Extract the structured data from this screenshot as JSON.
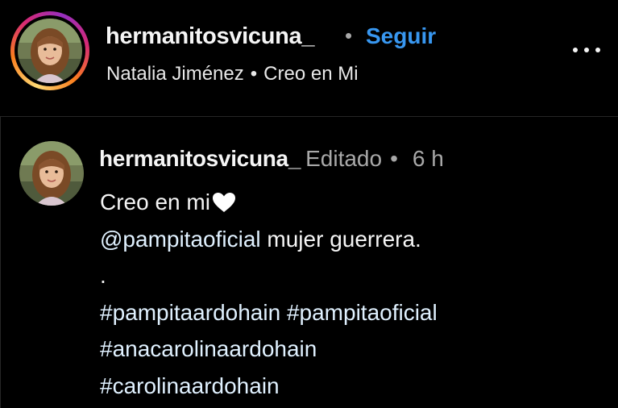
{
  "header": {
    "username": "hermanitosvicuna_",
    "separator": "•",
    "follow_label": "Seguir",
    "audio": {
      "artist": "Natalia Jiménez",
      "separator": "•",
      "song": "Creo en Mi"
    },
    "more_icon": "more-horizontal-icon"
  },
  "caption": {
    "username": "hermanitosvicuna_",
    "edited_label": "Editado",
    "separator": "•",
    "time": "6 h",
    "lines": {
      "line1": "Creo en mi",
      "line2_mention": "@pampitaoficial",
      "line2_rest": " mujer guerrera.",
      "line3": ".",
      "line4_tag1": "#pampitaardohain",
      "line4_tag2": "#pampitaoficial",
      "line5_tag": "#anacarolinaardohain",
      "line6_tag": "#carolinaardohain"
    },
    "heart_icon": "white-heart-icon"
  },
  "colors": {
    "background": "#000000",
    "text": "#f5f5f5",
    "muted": "#a8a8a8",
    "follow": "#3897f0",
    "divider": "#262626"
  }
}
